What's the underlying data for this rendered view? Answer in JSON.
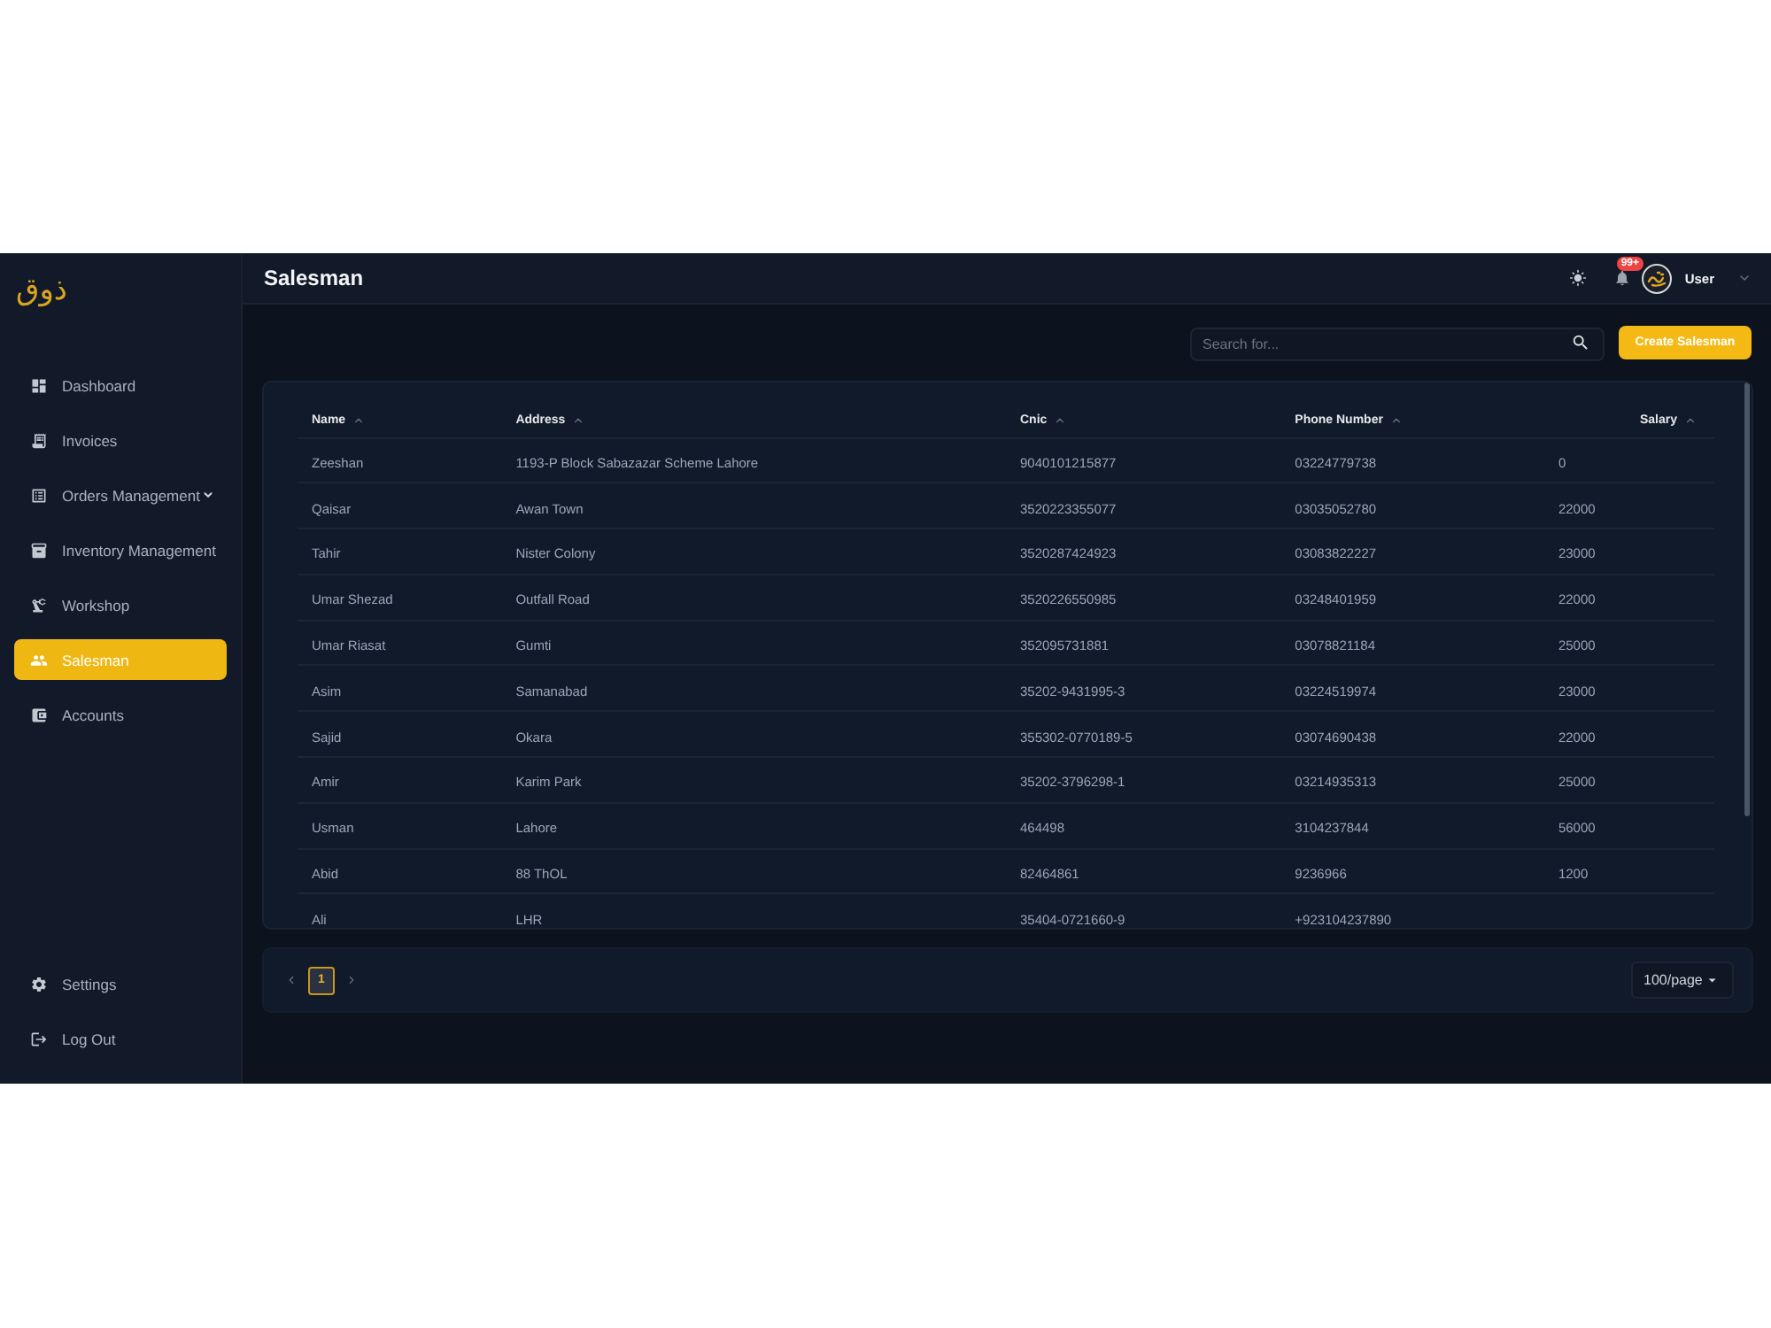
{
  "sidebar": {
    "logo": "ذوق",
    "items": [
      {
        "label": "Dashboard",
        "selected": false,
        "has_submenu": false
      },
      {
        "label": "Invoices",
        "selected": false,
        "has_submenu": false
      },
      {
        "label": "Orders Management",
        "selected": false,
        "has_submenu": true
      },
      {
        "label": "Inventory Management",
        "selected": false,
        "has_submenu": false
      },
      {
        "label": "Workshop",
        "selected": false,
        "has_submenu": false
      },
      {
        "label": "Salesman",
        "selected": true,
        "has_submenu": false
      },
      {
        "label": "Accounts",
        "selected": false,
        "has_submenu": false
      }
    ],
    "footer_items": [
      {
        "label": "Settings"
      },
      {
        "label": "Log Out"
      }
    ]
  },
  "header": {
    "title": "Salesman",
    "notification_badge": "99+",
    "user": "User"
  },
  "toolbar": {
    "search": {
      "placeholder": "Search for..."
    },
    "create_button": "Create Salesman"
  },
  "table": {
    "columns": [
      "Name",
      "Address",
      "Cnic",
      "Phone Number",
      "Salary"
    ],
    "rows": [
      [
        "Zeeshan",
        "1193-P Block Sabazazar Scheme Lahore",
        "9040101215877",
        "03224779738",
        "0"
      ],
      [
        "Qaisar",
        "Awan Town",
        "3520223355077",
        "03035052780",
        "22000"
      ],
      [
        "Tahir",
        "Nister Colony",
        "3520287424923",
        "03083822227",
        "23000"
      ],
      [
        "Umar Shezad",
        "Outfall Road",
        "3520226550985",
        "03248401959",
        "22000"
      ],
      [
        "Umar Riasat",
        "Gumti",
        "352095731881",
        "03078821184",
        "25000"
      ],
      [
        "Asim",
        "Samanabad",
        "35202-9431995-3",
        "03224519974",
        "23000"
      ],
      [
        "Sajid",
        "Okara",
        "355302-0770189-5",
        "03074690438",
        "22000"
      ],
      [
        "Amir",
        "Karim Park",
        "35202-3796298-1",
        "03214935313",
        "25000"
      ],
      [
        "Usman",
        "Lahore",
        "464498",
        "3104237844",
        "56000"
      ],
      [
        "Abid",
        "88 ThOL",
        "82464861",
        "9236966",
        "1200"
      ],
      [
        "Ali",
        "LHR",
        "35404-0721660-9",
        "+923104237890"
      ]
    ]
  },
  "pagination": {
    "pages": [
      {
        "label": "1",
        "selected": true
      }
    ],
    "page_size": "100/page"
  }
}
